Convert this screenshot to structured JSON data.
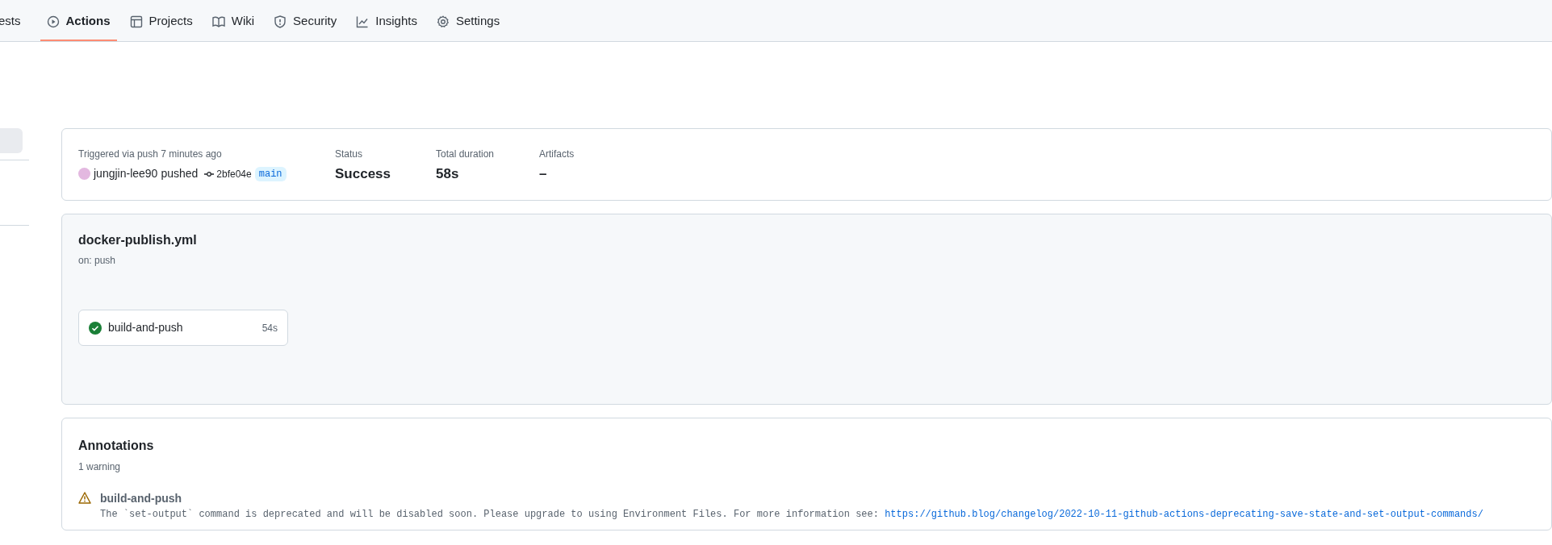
{
  "tabs": [
    {
      "label": "ests",
      "kind": "plain",
      "selected": false
    },
    {
      "label": "Actions",
      "kind": "play",
      "selected": true
    },
    {
      "label": "Projects",
      "kind": "table",
      "selected": false
    },
    {
      "label": "Wiki",
      "kind": "book",
      "selected": false
    },
    {
      "label": "Security",
      "kind": "shield",
      "selected": false
    },
    {
      "label": "Insights",
      "kind": "graph",
      "selected": false
    },
    {
      "label": "Settings",
      "kind": "gear",
      "selected": false
    }
  ],
  "summary": {
    "trigger": "Triggered via push 7 minutes ago",
    "actor": "jungjin-lee90",
    "action": "pushed",
    "commit": "2bfe04e",
    "branch": "main",
    "stats": [
      {
        "label": "Status",
        "value": "Success"
      },
      {
        "label": "Total duration",
        "value": "58s"
      },
      {
        "label": "Artifacts",
        "value": "–"
      }
    ]
  },
  "workflow": {
    "file": "docker-publish.yml",
    "trigger": "on: push",
    "jobs": [
      {
        "name": "build-and-push",
        "duration": "54s",
        "kind": "success"
      }
    ]
  },
  "annotations": {
    "title": "Annotations",
    "count": "1 warning",
    "items": [
      {
        "kind": "warning",
        "job": "build-and-push",
        "message": "The `set-output` command is deprecated and will be disabled soon. Please upgrade to using Environment Files. For more information see: ",
        "link": "https://github.blog/changelog/2022-10-11-github-actions-deprecating-save-state-and-set-output-commands/"
      }
    ]
  }
}
